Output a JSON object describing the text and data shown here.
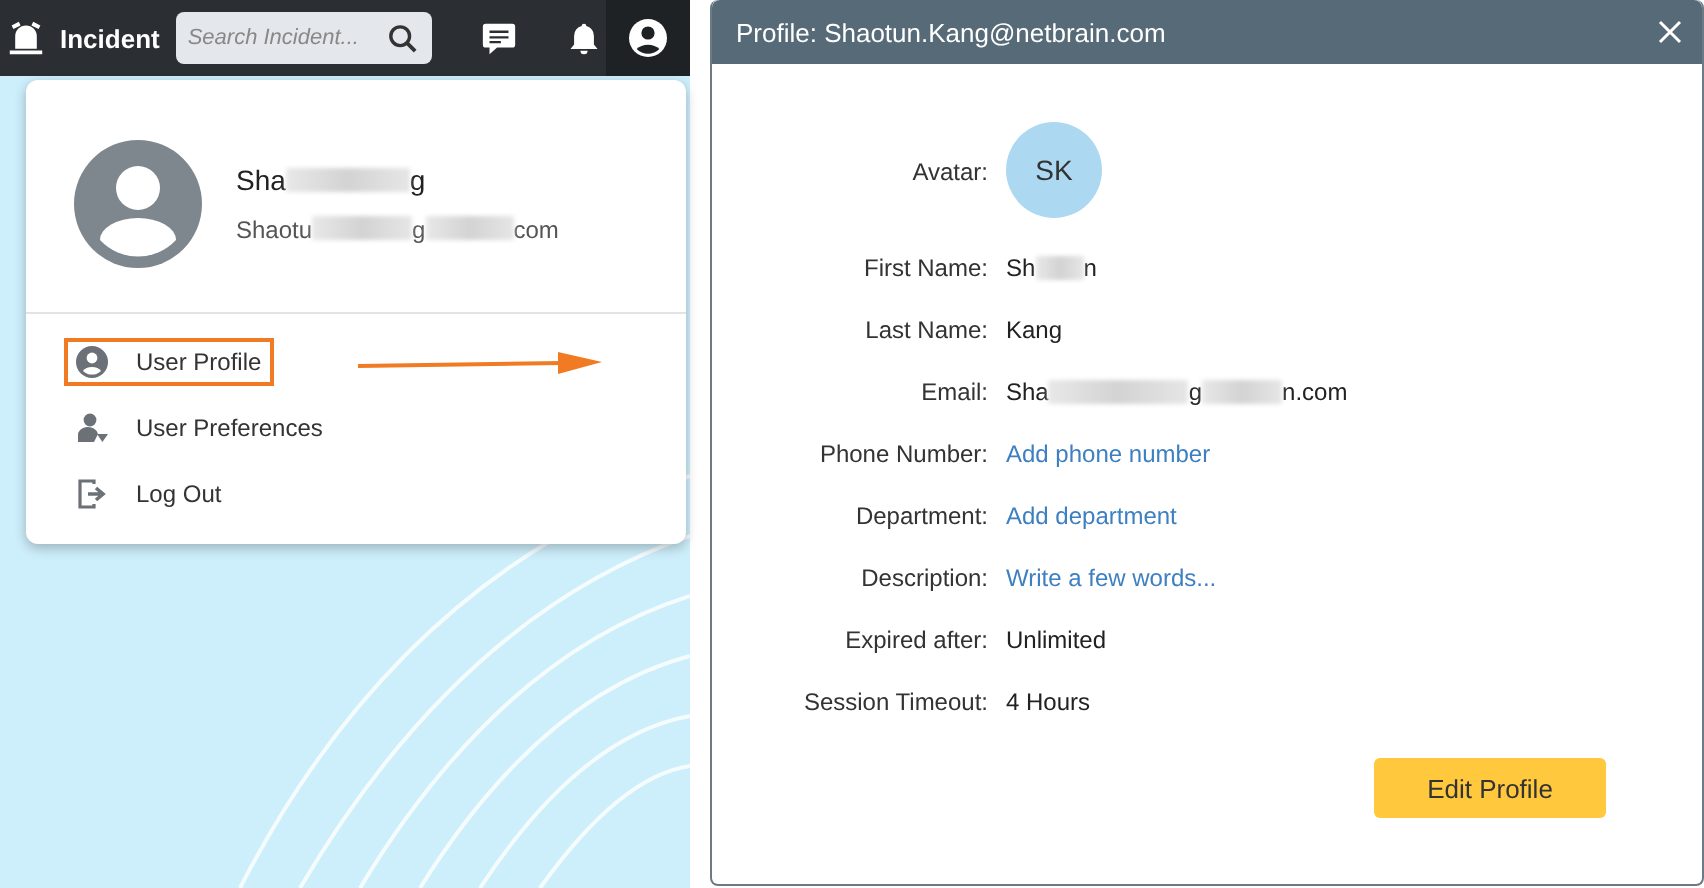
{
  "app_bar": {
    "title": "Incident",
    "search": {
      "placeholder": "Search Incident..."
    }
  },
  "user_menu": {
    "name_parts": [
      "Sha",
      "g"
    ],
    "email_parts": [
      "Shaotu",
      "g",
      "com"
    ],
    "items": [
      {
        "label": "User Profile",
        "kind": "profile",
        "highlighted": true
      },
      {
        "label": "User Preferences",
        "kind": "preferences",
        "highlighted": false
      },
      {
        "label": "Log Out",
        "kind": "logout",
        "highlighted": false
      }
    ]
  },
  "dialog": {
    "title": "Profile: Shaotun.Kang@netbrain.com",
    "avatar_label": "Avatar:",
    "avatar_initials": "SK",
    "fields": [
      {
        "label": "First Name:",
        "parts": [
          "Sh",
          "n"
        ],
        "kind": "text"
      },
      {
        "label": "Last Name:",
        "parts": [
          "Kang"
        ],
        "kind": "text"
      },
      {
        "label": "Email:",
        "parts": [
          "Sha",
          "g",
          "n.com"
        ],
        "kind": "text"
      },
      {
        "label": "Phone Number:",
        "parts": [
          "Add phone number"
        ],
        "kind": "link"
      },
      {
        "label": "Department:",
        "parts": [
          "Add department"
        ],
        "kind": "link"
      },
      {
        "label": "Description:",
        "parts": [
          "Write a few words..."
        ],
        "kind": "link"
      },
      {
        "label": "Expired after:",
        "parts": [
          "Unlimited"
        ],
        "kind": "text"
      },
      {
        "label": "Session Timeout:",
        "parts": [
          "4 Hours"
        ],
        "kind": "text"
      }
    ],
    "button": "Edit Profile"
  }
}
